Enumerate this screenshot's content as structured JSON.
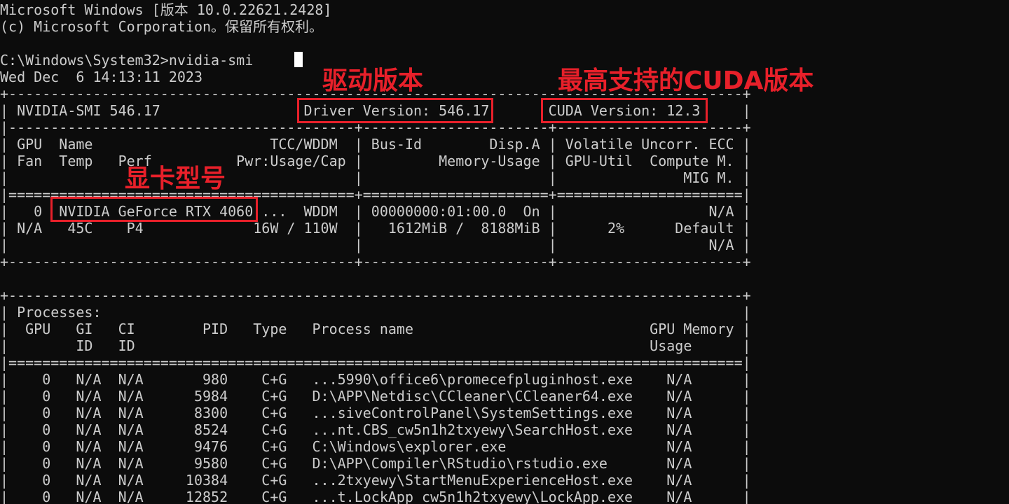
{
  "terminal": {
    "lines": [
      "Microsoft Windows [版本 10.0.22621.2428]",
      "(c) Microsoft Corporation。保留所有权利。",
      "",
      "C:\\Windows\\System32>nvidia-smi",
      "Wed Dec  6 14:13:11 2023",
      "+---------------------------------------------------------------------------------------+",
      "| NVIDIA-SMI 546.17                 Driver Version: 546.17       CUDA Version: 12.3     |",
      "|-----------------------------------------+----------------------+----------------------+",
      "| GPU  Name                     TCC/WDDM  | Bus-Id        Disp.A | Volatile Uncorr. ECC |",
      "| Fan  Temp   Perf          Pwr:Usage/Cap |         Memory-Usage | GPU-Util  Compute M. |",
      "|                                         |                      |               MIG M. |",
      "|=========================================+======================+======================|",
      "|   0  NVIDIA GeForce RTX 4060 ...  WDDM  | 00000000:01:00.0  On |                  N/A |",
      "| N/A   45C    P4             16W / 110W  |   1612MiB /  8188MiB |      2%      Default |",
      "|                                         |                      |                  N/A |",
      "+-----------------------------------------+----------------------+----------------------+",
      "",
      "+---------------------------------------------------------------------------------------+",
      "| Processes:                                                                            |",
      "|  GPU   GI   CI        PID   Type   Process name                            GPU Memory |",
      "|        ID   ID                                                             Usage      |",
      "|=======================================================================================|",
      "|    0   N/A  N/A       980    C+G   ...5990\\office6\\promecefpluginhost.exe    N/A      |",
      "|    0   N/A  N/A      5984    C+G   D:\\APP\\Netdisc\\CCleaner\\CCleaner64.exe    N/A      |",
      "|    0   N/A  N/A      8300    C+G   ...siveControlPanel\\SystemSettings.exe    N/A      |",
      "|    0   N/A  N/A      8524    C+G   ...nt.CBS_cw5n1h2txyewy\\SearchHost.exe    N/A      |",
      "|    0   N/A  N/A      9476    C+G   C:\\Windows\\explorer.exe                   N/A      |",
      "|    0   N/A  N/A      9580    C+G   D:\\APP\\Compiler\\RStudio\\rstudio.exe       N/A      |",
      "|    0   N/A  N/A     10384    C+G   ...2txyewy\\StartMenuExperienceHost.exe    N/A      |",
      "|    0   N/A  N/A     12852    C+G   ...t.LockApp_cw5n1h2txyewy\\LockApp.exe    N/A      |"
    ]
  },
  "annotations": {
    "driver_label": "驱动版本",
    "cuda_label": "最高支持的CUDA版本",
    "gpu_label": "显卡型号"
  },
  "colors": {
    "background": "#0c0c0c",
    "text": "#cccccc",
    "annotation": "#e8202a"
  }
}
